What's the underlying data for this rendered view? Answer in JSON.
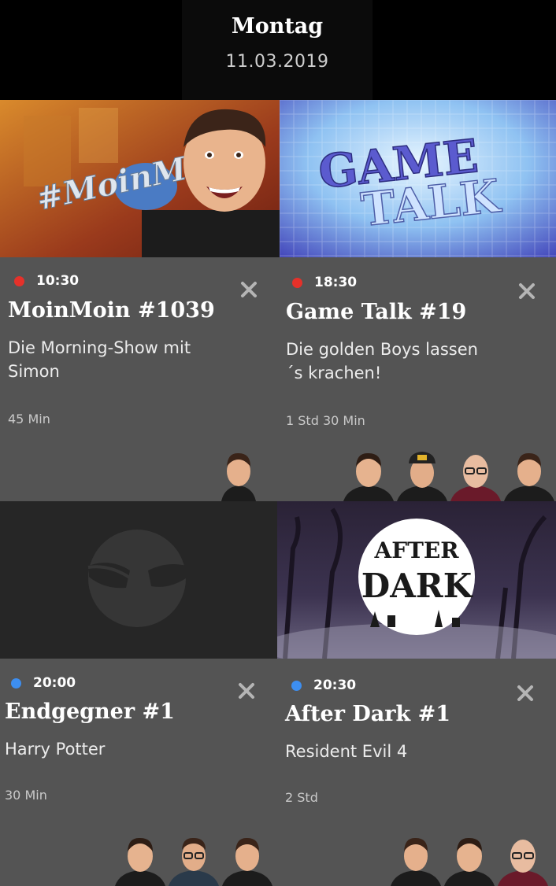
{
  "header": {
    "day": "Montag",
    "date": "11.03.2019"
  },
  "cards": [
    {
      "time": "10:30",
      "status": "live",
      "title": "MoinMoin #1039",
      "subtitle": "Die Morning-Show mit Simon",
      "duration": "45 Min",
      "thumbnail_text": "#MoinMo",
      "host_count": 1
    },
    {
      "time": "18:30",
      "status": "live",
      "title": "Game Talk #19",
      "subtitle": "Die golden Boys lassen ´s krachen!",
      "duration": "1 Std 30 Min",
      "thumbnail_text_1": "GAME",
      "thumbnail_text_2": "TALK",
      "host_count": 4
    },
    {
      "time": "20:00",
      "status": "upcoming",
      "title": "Endgegner #1",
      "subtitle": "Harry Potter",
      "duration": "30 Min",
      "host_count": 3
    },
    {
      "time": "20:30",
      "status": "upcoming",
      "title": "After Dark #1",
      "subtitle": "Resident Evil 4",
      "duration": "2 Std",
      "thumbnail_text_1": "AFTER",
      "thumbnail_text_2": "DARK",
      "host_count": 3
    }
  ],
  "colors": {
    "live_dot": "#e5312a",
    "upcoming_dot": "#3d8ef0",
    "card_bg": "#545454",
    "page_bg": "#000000"
  },
  "icons": {
    "close": "close-icon",
    "live": "live-dot-icon",
    "upcoming": "upcoming-dot-icon"
  }
}
